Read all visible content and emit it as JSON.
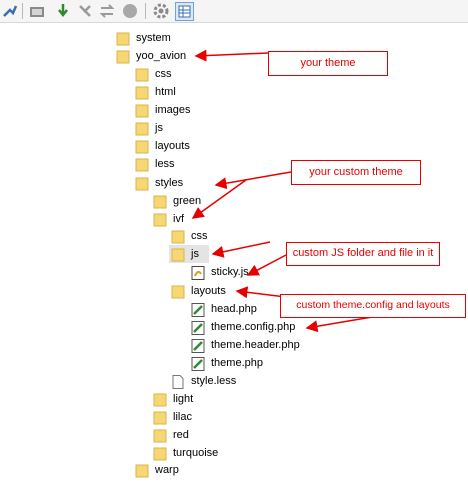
{
  "toolbar": {
    "buttons": [
      "connect-icon",
      "open-folder-icon",
      "download-icon",
      "upload-icon",
      "refresh-icon",
      "stop-icon",
      "settings-icon",
      "view-icon"
    ]
  },
  "tree": {
    "system": "system",
    "yoo_avion": "yoo_avion",
    "css": "css",
    "html": "html",
    "images": "images",
    "js": "js",
    "layouts": "layouts",
    "less": "less",
    "styles": "styles",
    "green": "green",
    "ivf": "ivf",
    "ivf_css": "css",
    "ivf_js": "js",
    "sticky": "sticky.js",
    "ivf_layouts": "layouts",
    "head": "head.php",
    "theme_config": "theme.config.php",
    "theme_header": "theme.header.php",
    "theme": "theme.php",
    "style_less": "style.less",
    "light": "light",
    "lilac": "lilac",
    "red": "red",
    "turquoise": "turquoise",
    "warp": "warp"
  },
  "callouts": {
    "your_theme": "your theme",
    "your_custom_theme": "your custom theme",
    "custom_js": "custom JS folder and file in it",
    "custom_config": "custom theme.config and layouts"
  },
  "colors": {
    "annotation": "#e60000",
    "folder": "#f7d774",
    "selection": "#e4e4e4"
  }
}
